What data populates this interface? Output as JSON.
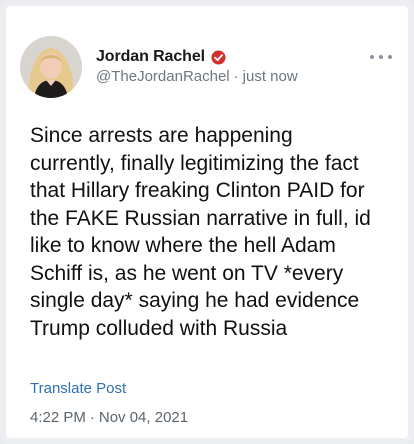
{
  "tweet": {
    "author": {
      "display_name": "Jordan Rachel",
      "handle": "@TheJordanRachel",
      "verified_icon": "verified-badge-icon",
      "avatar": "profile-photo"
    },
    "time_ago": "just now",
    "separator": "·",
    "body_lines": [
      "Since arrests are happening",
      "currently, finally legitimizing the fact",
      "that Hillary freaking Clinton PAID for",
      "the FAKE Russian narrative in full, id",
      "like to know where the hell Adam",
      "Schiff is, as he went on TV *every",
      "single day* saying he had evidence",
      "Trump colluded with Russia"
    ],
    "translate_label": "Translate Post",
    "time": "4:22 PM",
    "date": "Nov 04, 2021",
    "more_icon": "more-options-icon"
  },
  "colors": {
    "verified_badge": "#d0312d",
    "link": "#2f6fb3",
    "secondary_text": "#6f767d"
  }
}
